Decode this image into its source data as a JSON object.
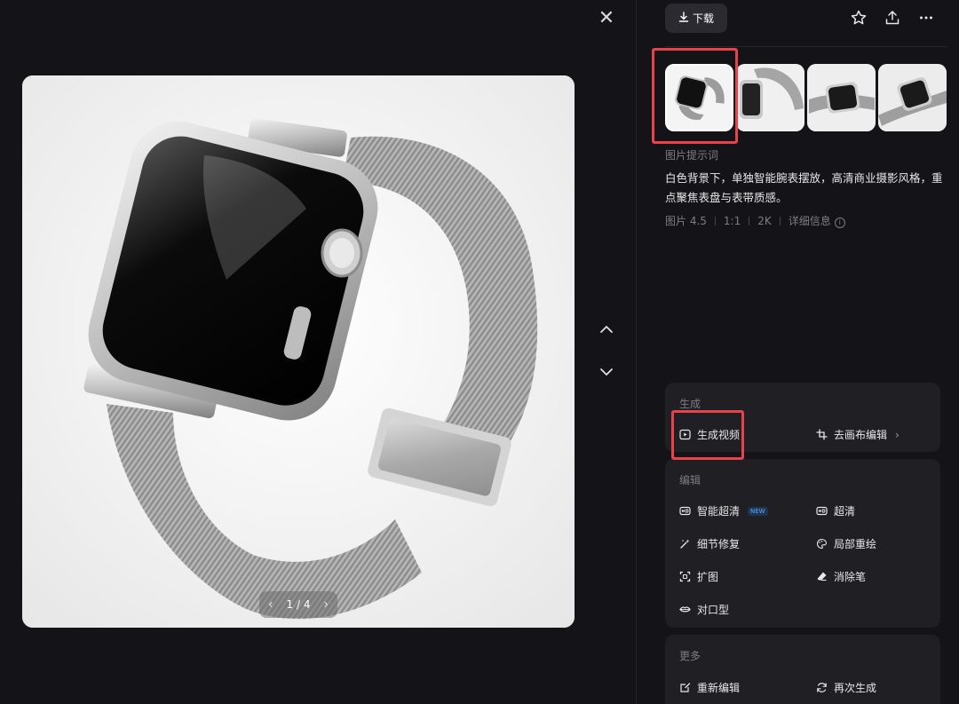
{
  "viewer": {
    "pager": {
      "current": "1",
      "separator": "/",
      "total": "4",
      "prev_icon": "chevron-left-icon",
      "next_icon": "chevron-right-icon"
    },
    "close_icon": "close-icon",
    "nav_up_icon": "chevron-up-icon",
    "nav_down_icon": "chevron-down-icon"
  },
  "toolbar": {
    "download_label": "下载",
    "download_icon": "download-icon",
    "favorite_icon": "star-icon",
    "share_icon": "share-icon",
    "more_icon": "more-icon"
  },
  "thumbnails": [
    {
      "name": "thumb-1",
      "selected": true
    },
    {
      "name": "thumb-2",
      "selected": false
    },
    {
      "name": "thumb-3",
      "selected": false
    },
    {
      "name": "thumb-4",
      "selected": false
    }
  ],
  "prompt": {
    "label": "图片提示词",
    "text": "白色背景下，单独智能腕表摆放，高清商业摄影风格，重点聚焦表盘与表带质感。"
  },
  "meta": {
    "model": "图片 4.5",
    "ratio": "1:1",
    "resolution": "2K",
    "details": "详细信息"
  },
  "generate": {
    "title": "生成",
    "video_label": "生成视频",
    "canvas_label": "去画布编辑"
  },
  "edit": {
    "title": "编辑",
    "smart_hd_label": "智能超清",
    "new_badge": "NEW",
    "hd_label": "超清",
    "detail_fix_label": "细节修复",
    "inpaint_label": "局部重绘",
    "expand_label": "扩图",
    "eraser_label": "消除笔",
    "lipsync_label": "对口型"
  },
  "more": {
    "title": "更多",
    "reedit_label": "重新编辑",
    "regenerate_label": "再次生成"
  },
  "colors": {
    "background": "#141418",
    "card": "#1f1f24",
    "highlight": "#e8424d",
    "muted_text": "#7d7d84",
    "new_badge": "#5aa9ff"
  }
}
